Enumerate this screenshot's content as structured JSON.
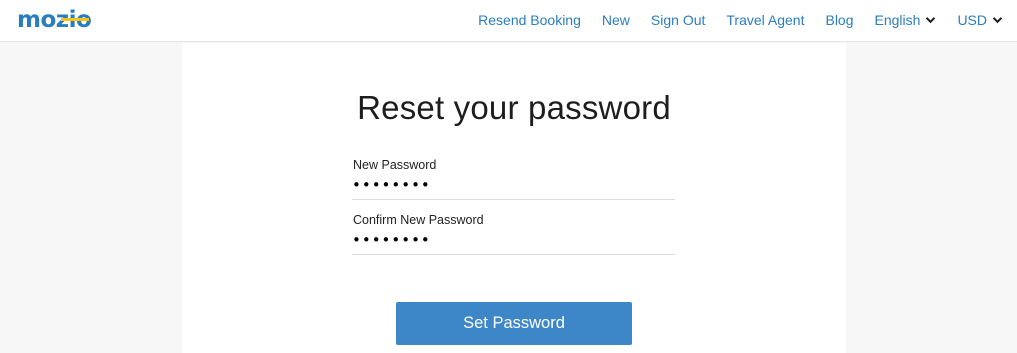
{
  "header": {
    "logo_text": "mozio",
    "nav": [
      {
        "label": "Resend Booking"
      },
      {
        "label": "New"
      },
      {
        "label": "Sign Out"
      },
      {
        "label": "Travel Agent"
      },
      {
        "label": "Blog"
      },
      {
        "label": "English",
        "dropdown": true
      },
      {
        "label": "USD",
        "dropdown": true
      }
    ]
  },
  "form": {
    "title": "Reset your password",
    "new_password": {
      "label": "New Password",
      "value": "••••••••"
    },
    "confirm_password": {
      "label": "Confirm New Password",
      "value": "••••••••"
    },
    "submit_label": "Set Password"
  },
  "colors": {
    "link": "#2b7dc2",
    "button": "#3d86c8",
    "logo_primary": "#2b7dc2",
    "logo_accent": "#f5c518",
    "page_bg": "#f7f7f7"
  }
}
